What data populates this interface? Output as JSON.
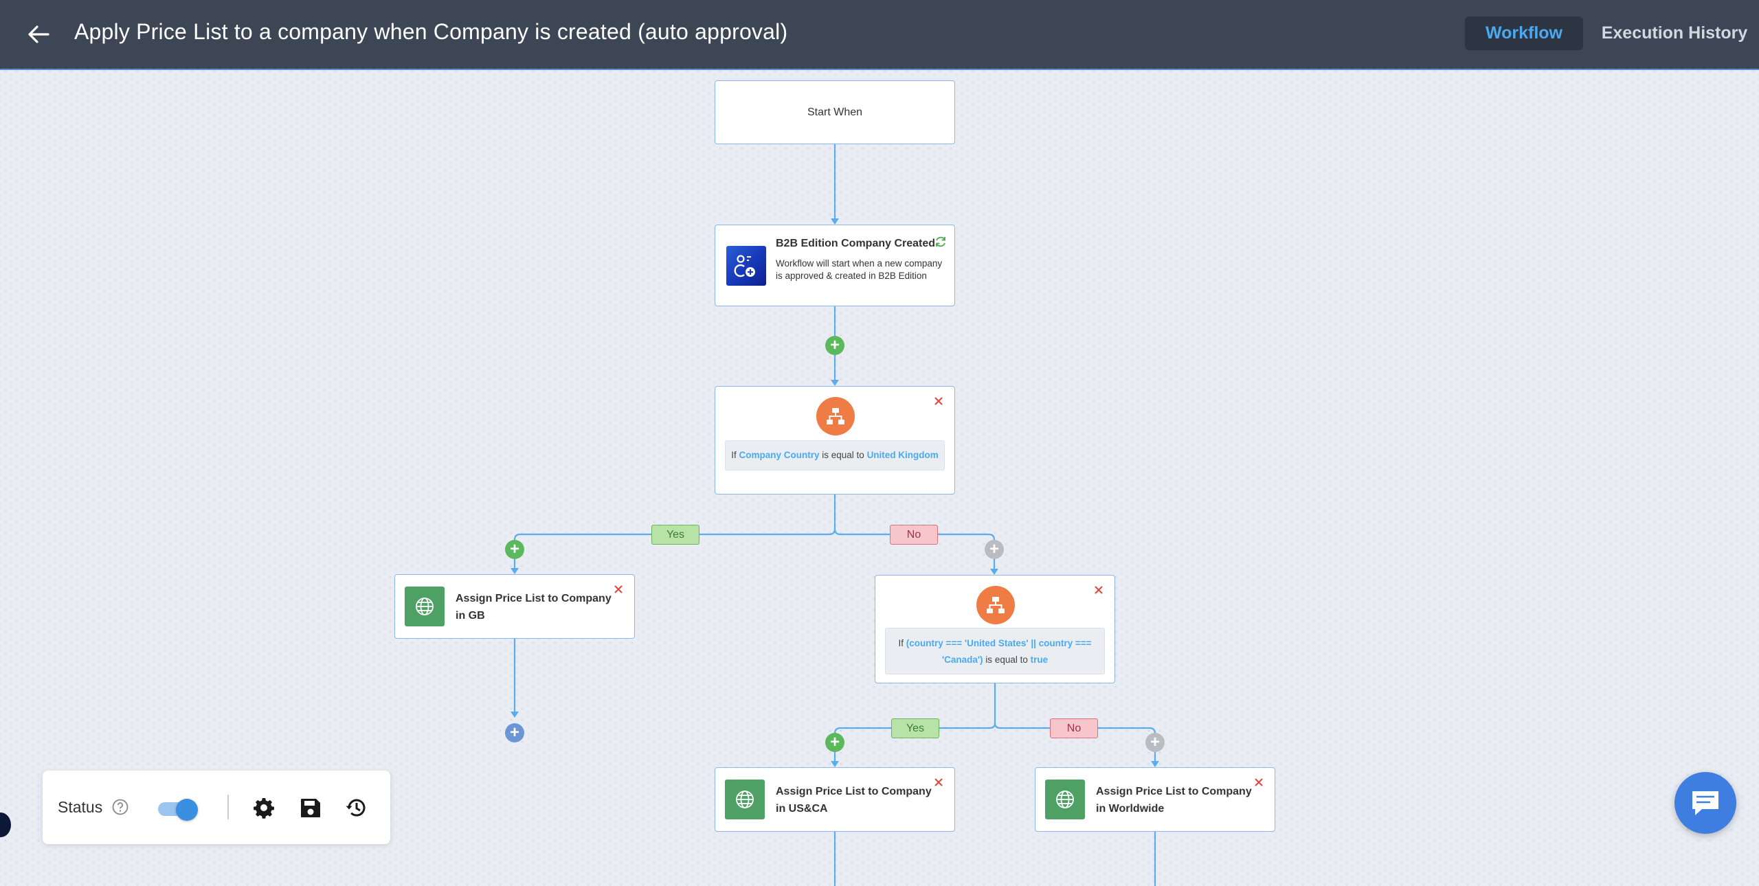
{
  "header": {
    "title": "Apply Price List to a company when Company is created (auto approval)",
    "tabs": [
      {
        "label": "Workflow",
        "active": true
      },
      {
        "label": "Execution History",
        "active": false
      }
    ]
  },
  "workflow": {
    "start_node": {
      "label": "Start When"
    },
    "trigger": {
      "title": "B2B Edition Company Created",
      "description": "Workflow will start when a new company is approved & created in B2B Edition"
    },
    "condition_1": {
      "prefix": "If",
      "field": "Company Country",
      "operator": "is equal to",
      "value": "United Kingdom"
    },
    "branch_1": {
      "yes": "Yes",
      "no": "No"
    },
    "action_gb": {
      "title": "Assign Price List to Company in GB"
    },
    "condition_2": {
      "prefix": "If",
      "field": "(country === 'United States' || country === 'Canada')",
      "operator": "is equal to",
      "value": "true"
    },
    "branch_2": {
      "yes": "Yes",
      "no": "No"
    },
    "action_us": {
      "title": "Assign Price List to Company in US&CA"
    },
    "action_ww": {
      "title": "Assign Price List to Company in Worldwide"
    }
  },
  "status_panel": {
    "label": "Status",
    "enabled": true
  },
  "colors": {
    "header_bg": "#3d4655",
    "accent": "#4aa9f0",
    "connector": "#5aacf0",
    "condition": "#ef7b45",
    "action": "#4ea065",
    "yes": "#b7e3a8",
    "no": "#f6c6cc"
  },
  "icons": {
    "back": "arrow-left-icon",
    "trigger": "company-plus-icon",
    "sync": "sync-icon",
    "condition": "sitemap-icon",
    "action": "globe-icon",
    "close": "close-icon",
    "help": "help-circle-icon",
    "settings": "gear-icon",
    "save": "floppy-disk-icon",
    "history": "history-icon",
    "chat": "chat-bubble-icon"
  }
}
